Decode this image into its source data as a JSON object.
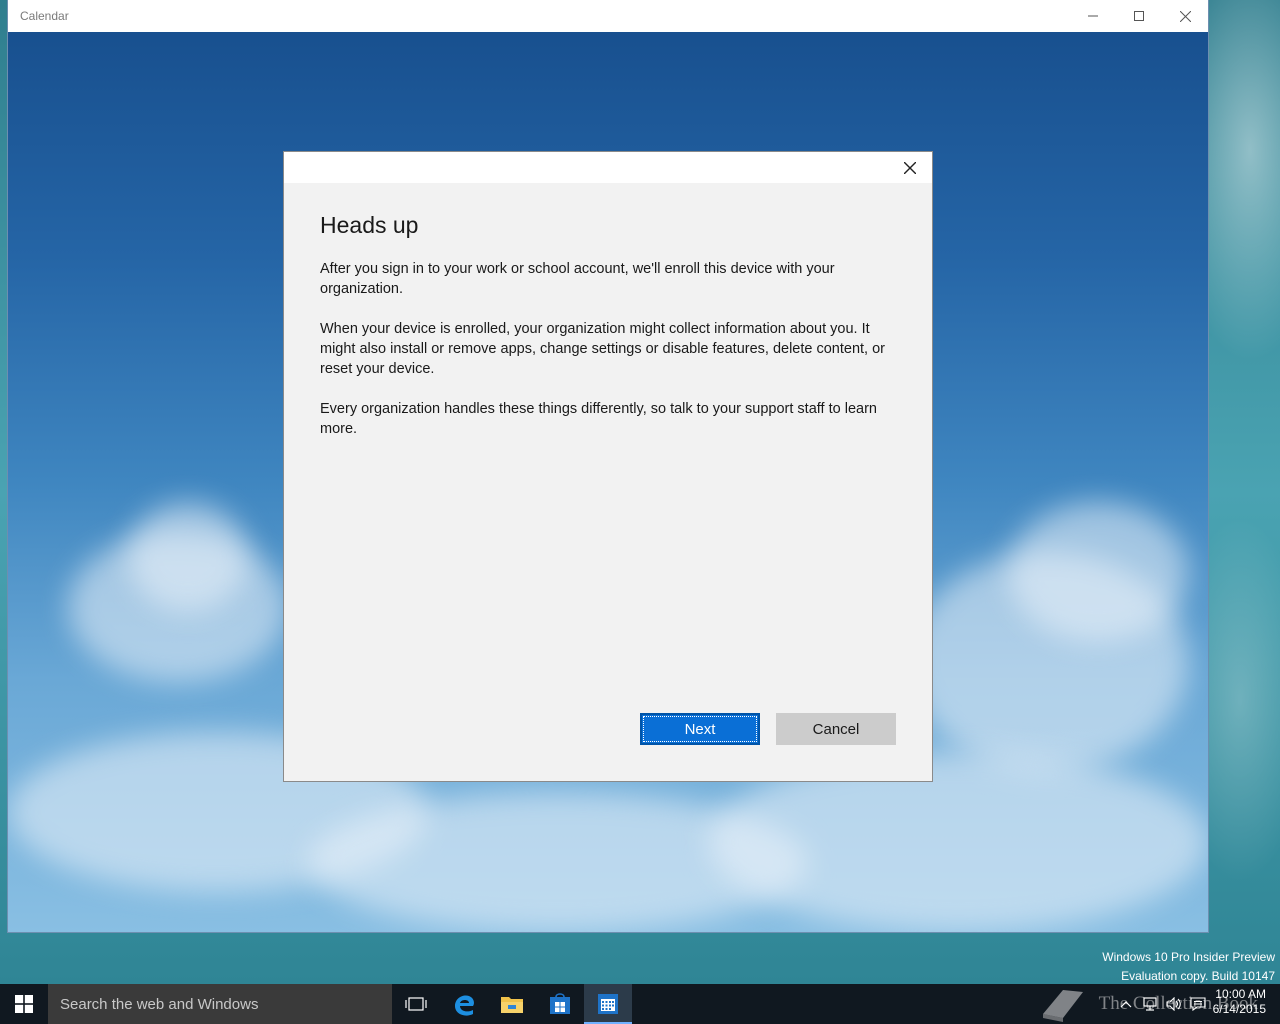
{
  "window": {
    "title": "Calendar"
  },
  "dialog": {
    "title": "Heads up",
    "paragraphs": [
      "After you sign in to your work or school account, we'll enroll this device with your organization.",
      "When your device is enrolled, your organization might collect information about you. It might also install or remove apps, change settings or disable features, delete content, or reset your device.",
      "Every organization handles these things differently, so talk to your support staff to learn more."
    ],
    "next_label": "Next",
    "cancel_label": "Cancel"
  },
  "watermark": {
    "line1": "Windows 10 Pro Insider Preview",
    "line2": "Evaluation copy. Build 10147"
  },
  "taskbar": {
    "search_placeholder": "Search the web and Windows",
    "brand_text": "The Collection Book",
    "clock_time": "10:00 AM",
    "clock_date": "6/14/2015",
    "icons": [
      "task-view-icon",
      "edge-icon",
      "file-explorer-icon",
      "store-icon",
      "calendar-app-icon"
    ]
  },
  "colors": {
    "accent": "#0a6fd6",
    "taskbar": "#101820",
    "dialog_bg": "#f2f2f2"
  }
}
